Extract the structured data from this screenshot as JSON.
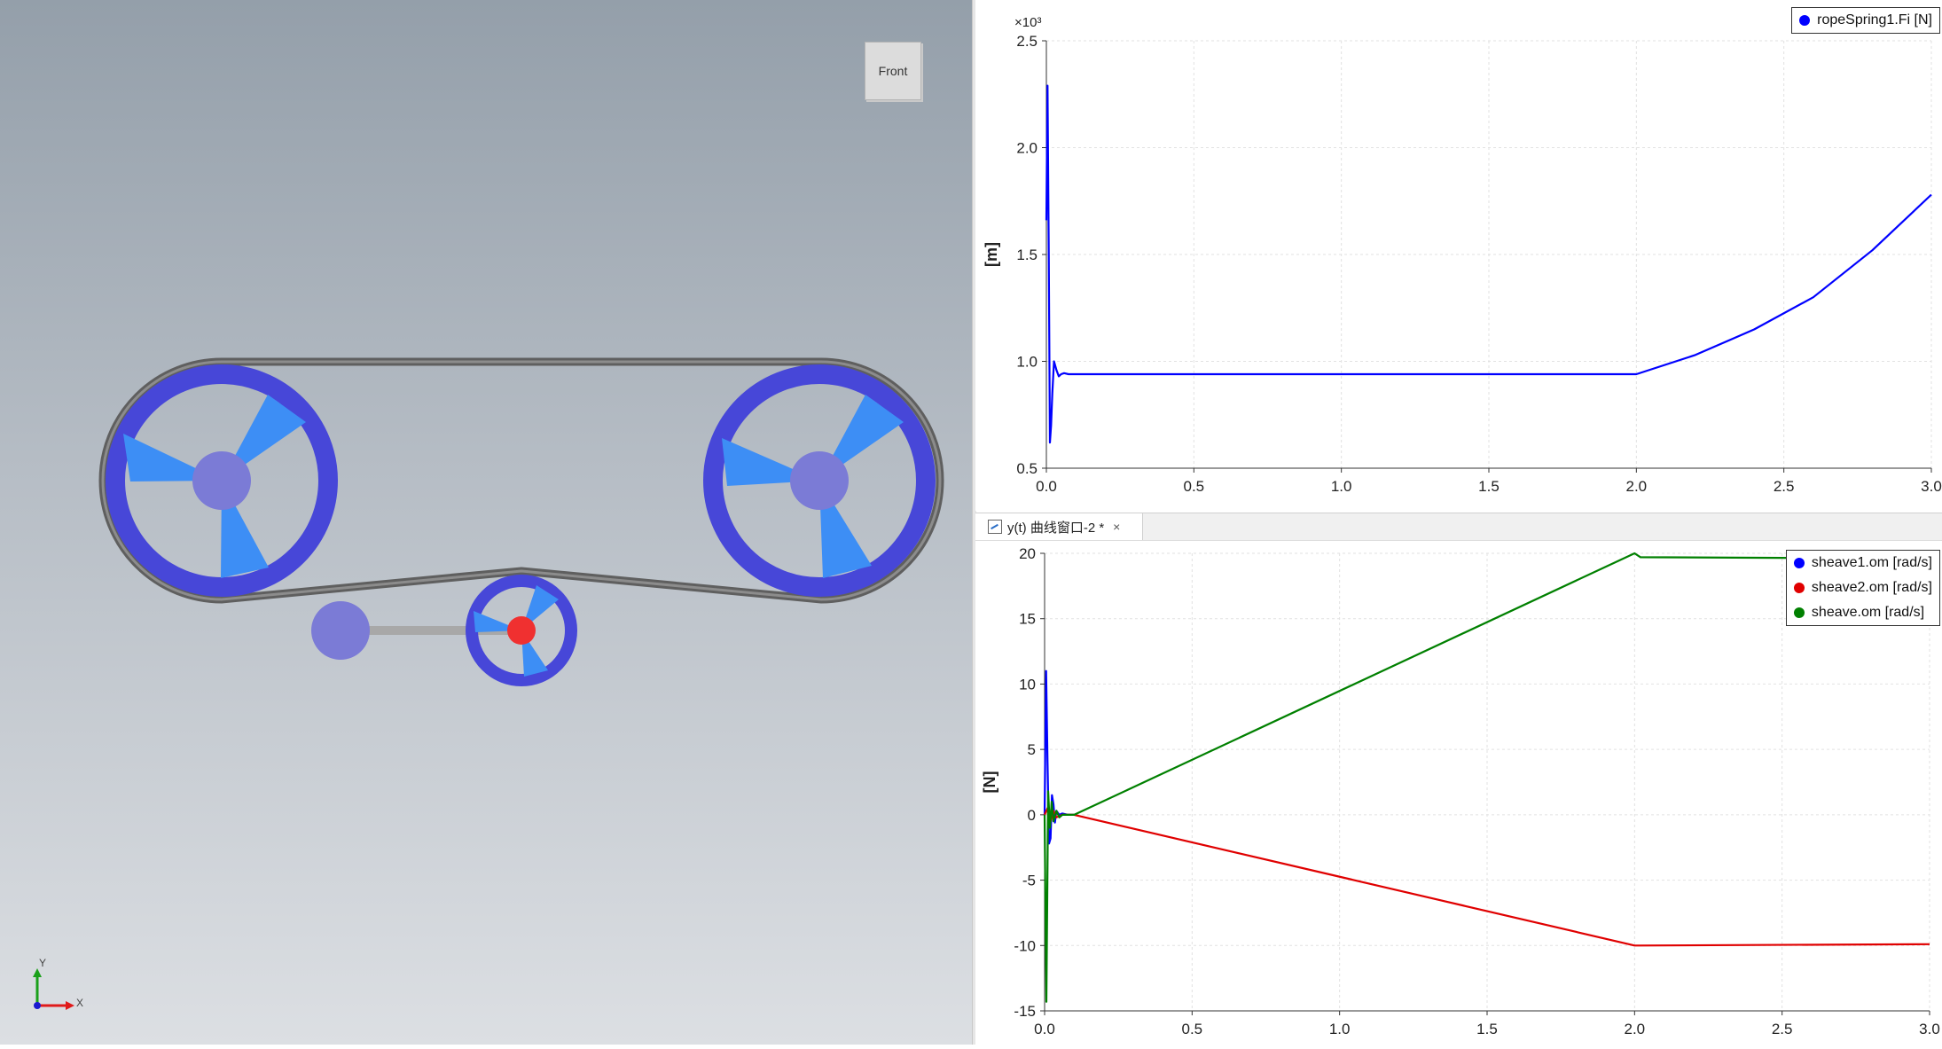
{
  "viewport": {
    "view_cube_label": "Front",
    "axis_x_label": "X",
    "axis_y_label": "Y",
    "colors": {
      "sheave_ring": "#4747d8",
      "spoke": "#3d8ef5",
      "hub": "#7b7bd6",
      "small_hub": "#f03030",
      "rope": "#5f5f5f",
      "lever": "#a8a8a8"
    }
  },
  "plot_top": {
    "legend": [
      {
        "label": "ropeSpring1.Fi [N]",
        "color": "#0000ff"
      }
    ],
    "chart_data": {
      "type": "line",
      "ylabel": "[m]",
      "exponent_label": "×10³",
      "xlim": [
        0,
        3
      ],
      "ylim": [
        0.5,
        2.5
      ],
      "x_ticks": [
        "0.0",
        "0.5",
        "1.0",
        "1.5",
        "2.0",
        "2.5",
        "3.0"
      ],
      "y_ticks": [
        "2.5",
        "2.0",
        "1.5",
        "1.0",
        "0.5"
      ],
      "grid": true,
      "legend_position": "top-right",
      "series": [
        {
          "name": "ropeSpring1.Fi [N]",
          "color": "#0000ff",
          "x": [
            0,
            0.004,
            0.008,
            0.012,
            0.016,
            0.02,
            0.026,
            0.034,
            0.042,
            0.05,
            0.06,
            0.075,
            0.1,
            0.5,
            1.0,
            1.5,
            2.0,
            2.2,
            2.4,
            2.6,
            2.8,
            3.0
          ],
          "y": [
            1.66,
            2.29,
            1.5,
            0.62,
            0.7,
            0.85,
            1.0,
            0.96,
            0.93,
            0.94,
            0.945,
            0.94,
            0.94,
            0.94,
            0.94,
            0.94,
            0.94,
            1.03,
            1.15,
            1.3,
            1.52,
            1.78
          ]
        }
      ]
    }
  },
  "plot_bottom": {
    "tab": {
      "title": "y(t) 曲线窗口-2 *",
      "close_glyph": "×"
    },
    "legend": [
      {
        "label": "sheave1.om [rad/s]",
        "color": "#0000ff"
      },
      {
        "label": "sheave2.om [rad/s]",
        "color": "#e00000"
      },
      {
        "label": "sheave.om [rad/s]",
        "color": "#008000"
      }
    ],
    "chart_data": {
      "type": "line",
      "ylabel": "[N]",
      "xlim": [
        0,
        3
      ],
      "ylim": [
        -15,
        20
      ],
      "x_ticks": [
        "0.0",
        "0.5",
        "1.0",
        "1.5",
        "2.0",
        "2.5",
        "3.0"
      ],
      "y_ticks": [
        "20",
        "15",
        "10",
        "5",
        "0",
        "-5",
        "-10",
        "-15"
      ],
      "grid": true,
      "legend_position": "top-right",
      "series": [
        {
          "name": "sheave1.om [rad/s]",
          "color": "#0000ff",
          "x": [
            0,
            0.005,
            0.01,
            0.015,
            0.02,
            0.025,
            0.03,
            0.035,
            0.04,
            0.05,
            0.06,
            0.08,
            0.1
          ],
          "y": [
            0,
            11,
            4,
            -2.2,
            -1.8,
            1.5,
            0.8,
            -0.6,
            0.3,
            0,
            0.1,
            0,
            0
          ]
        },
        {
          "name": "sheave2.om [rad/s]",
          "color": "#e00000",
          "x": [
            0,
            0.01,
            0.02,
            0.03,
            0.04,
            0.06,
            0.08,
            0.1,
            2.0,
            2.02,
            3.0
          ],
          "y": [
            0,
            0.5,
            -0.5,
            0.3,
            -0.2,
            0,
            0,
            0,
            -10,
            -10,
            -9.9
          ]
        },
        {
          "name": "sheave.om [rad/s]",
          "color": "#008000",
          "x": [
            0,
            0.006,
            0.012,
            0.018,
            0.024,
            0.03,
            0.04,
            0.05,
            0.06,
            0.08,
            0.1,
            2.0,
            2.02,
            3.0
          ],
          "y": [
            0,
            -14.3,
            1.8,
            -1.0,
            1.0,
            -0.5,
            0.3,
            -0.2,
            0,
            0,
            0,
            20,
            19.7,
            19.6
          ]
        }
      ]
    }
  }
}
